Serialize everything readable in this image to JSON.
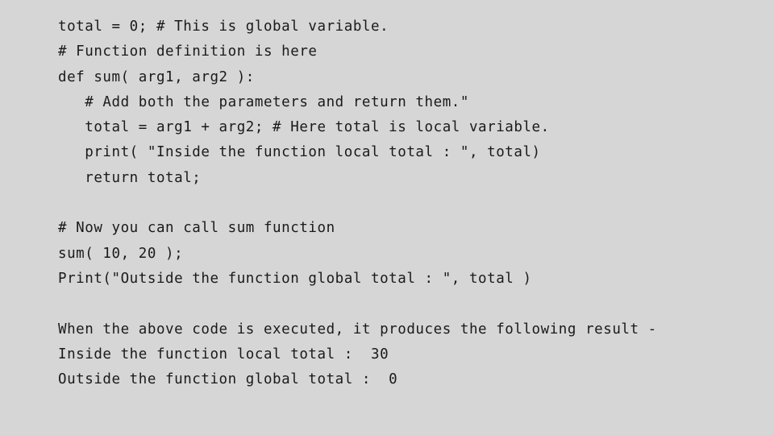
{
  "slide": {
    "background_color": "#d6d6d6",
    "text_color": "#1a1a1a",
    "title": "",
    "lines": [
      "total = 0; # This is global variable.",
      "# Function definition is here",
      "def sum( arg1, arg2 ):",
      "   # Add both the parameters and return them.\"",
      "   total = arg1 + arg2; # Here total is local variable.",
      "   print( \"Inside the function local total : \", total)",
      "   return total;",
      "",
      "# Now you can call sum function",
      "sum( 10, 20 );",
      "Print(\"Outside the function global total : \", total )",
      "",
      "When the above code is executed, it produces the following result -",
      "Inside the function local total :  30",
      "Outside the function global total :  0"
    ]
  }
}
